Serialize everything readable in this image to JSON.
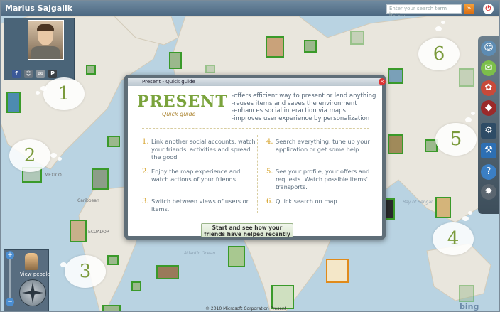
{
  "app": {
    "user_name": "Marius Sajgalik",
    "search": {
      "placeholder": "Enter your search term here..."
    },
    "colors": {
      "accent_green": "#3a9a2a",
      "titlebar": "#4b6780",
      "go_button": "#d86b10",
      "close": "#d33"
    }
  },
  "profile": {
    "social_icons": [
      "facebook-icon",
      "group-icon",
      "mail-icon",
      "p-icon"
    ]
  },
  "tutorial_bubbles": [
    "1",
    "2",
    "3",
    "4",
    "5",
    "6"
  ],
  "dock": {
    "items": [
      "person-icon",
      "gift-icon",
      "christmas-gift-icon",
      "car-icon",
      "settings-icon",
      "help-icon",
      "tools-icon"
    ]
  },
  "nav": {
    "view_people": "View people"
  },
  "map_labels": {
    "mexico": "MEXICO",
    "caribbean": "Caribbean",
    "ecuador": "ECUADOR",
    "atlantic": "Atlantic Ocean",
    "bay_of_bengal": "Bay of Bengal"
  },
  "footer": "© 2010 Microsoft Corporation   Present",
  "bing": "bing",
  "dialog": {
    "title": "Present - Quick guide",
    "logo": "PRESENT",
    "logo_sub": "Quick guide",
    "features": [
      "-offers efficient way to present or lend anything",
      "-reuses items and saves the environment",
      "-enhances social interaction via maps",
      "-improves user experience by personalization"
    ],
    "steps": [
      {
        "num": "1.",
        "text": "Link another social accounts, watch your friends' activities and spread the good"
      },
      {
        "num": "2.",
        "text": "Enjoy the map experience and watch actions of your friends"
      },
      {
        "num": "3.",
        "text": "Switch between views of users or items."
      },
      {
        "num": "4.",
        "text": "Search everything, tune up your application or get some help"
      },
      {
        "num": "5.",
        "text": "See your profile, your offers and requests. Watch possible items' transports."
      },
      {
        "num": "6.",
        "text": "Quick search on map"
      }
    ],
    "start_button": "Start and see how your friends have helped recently"
  }
}
